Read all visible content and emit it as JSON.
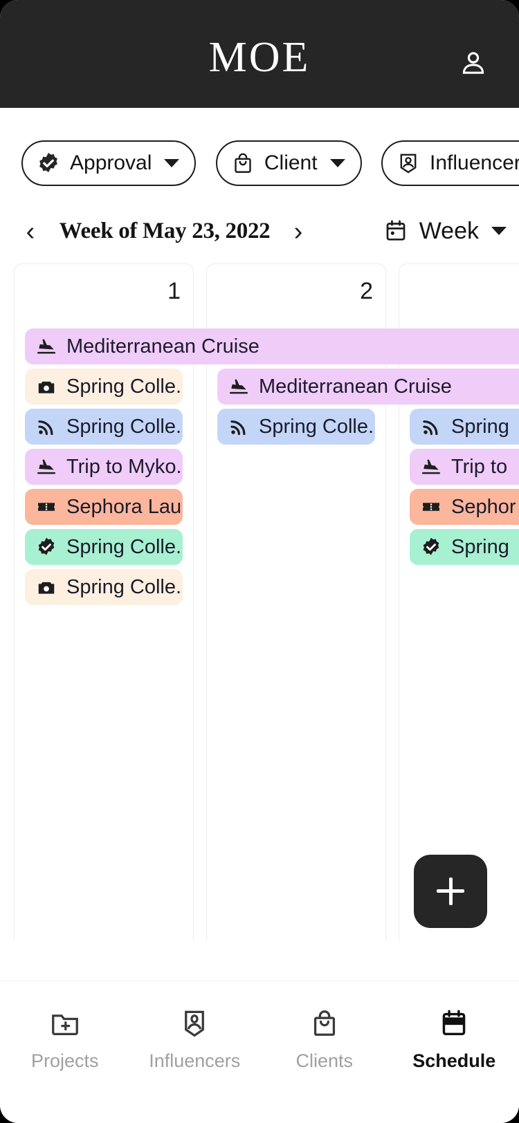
{
  "app": {
    "brand": "MOE",
    "account_icon": "person-icon",
    "header_bg": "#262626"
  },
  "filters": [
    {
      "label": "Approval",
      "icon": "verified-badge-icon",
      "caret": "chevron-down-icon"
    },
    {
      "label": "Client",
      "icon": "shopping-bag-icon",
      "caret": "chevron-down-icon"
    },
    {
      "label": "Influencer",
      "icon": "influencer-pin-icon",
      "caret": "chevron-down-icon"
    }
  ],
  "datebar": {
    "prev": "‹",
    "next": "›",
    "title": "Week of May 23, 2022",
    "view_label": "Week",
    "view_icon": "calendar-icon",
    "view_caret": "chevron-down-icon"
  },
  "calendar": {
    "columns": [
      {
        "daynum": "1"
      },
      {
        "daynum": "2"
      },
      {
        "daynum": ""
      }
    ],
    "events": [
      {
        "label": "Mediterranean Cruise",
        "icon": "plane-landing-icon",
        "color": "#f0ccf9",
        "col": 0,
        "row": 0,
        "span": 3
      },
      {
        "label": "Spring Colle...",
        "icon": "camera-icon",
        "color": "#fdf0e0",
        "col": 0,
        "row": 1,
        "span": 1
      },
      {
        "label": "Spring Colle...",
        "icon": "rss-icon",
        "color": "#c4d6f7",
        "col": 0,
        "row": 2,
        "span": 1
      },
      {
        "label": "Trip to Myko...",
        "icon": "plane-landing-icon",
        "color": "#f0ccf9",
        "col": 0,
        "row": 3,
        "span": 1
      },
      {
        "label": "Sephora Lau...",
        "icon": "ticket-icon",
        "color": "#fbb69c",
        "col": 0,
        "row": 4,
        "span": 1
      },
      {
        "label": "Spring Colle...",
        "icon": "verified-badge-icon",
        "color": "#a8f0d2",
        "col": 0,
        "row": 5,
        "span": 1
      },
      {
        "label": "Spring Colle...",
        "icon": "camera-icon",
        "color": "#fdf0e0",
        "col": 0,
        "row": 6,
        "span": 1
      },
      {
        "label": "Mediterranean Cruise",
        "icon": "plane-landing-icon",
        "color": "#f0ccf9",
        "col": 1,
        "row": 1,
        "span": 3
      },
      {
        "label": "Spring Colle...",
        "icon": "rss-icon",
        "color": "#c4d6f7",
        "col": 1,
        "row": 2,
        "span": 1
      },
      {
        "label": "Spring",
        "icon": "rss-icon",
        "color": "#c4d6f7",
        "col": 2,
        "row": 2,
        "span": 1
      },
      {
        "label": "Trip to",
        "icon": "plane-landing-icon",
        "color": "#f0ccf9",
        "col": 2,
        "row": 3,
        "span": 1
      },
      {
        "label": "Sephor",
        "icon": "ticket-icon",
        "color": "#fbb69c",
        "col": 2,
        "row": 4,
        "span": 1
      },
      {
        "label": "Spring",
        "icon": "verified-badge-icon",
        "color": "#a8f0d2",
        "col": 2,
        "row": 5,
        "span": 1
      }
    ]
  },
  "fab": {
    "icon": "plus-icon",
    "label": "+"
  },
  "bottomnav": {
    "items": [
      {
        "label": "Projects",
        "icon": "folder-plus-icon",
        "active": false
      },
      {
        "label": "Influencers",
        "icon": "influencer-pin-icon",
        "active": false
      },
      {
        "label": "Clients",
        "icon": "shopping-bag-icon",
        "active": false
      },
      {
        "label": "Schedule",
        "icon": "calendar-icon",
        "active": true
      }
    ]
  }
}
